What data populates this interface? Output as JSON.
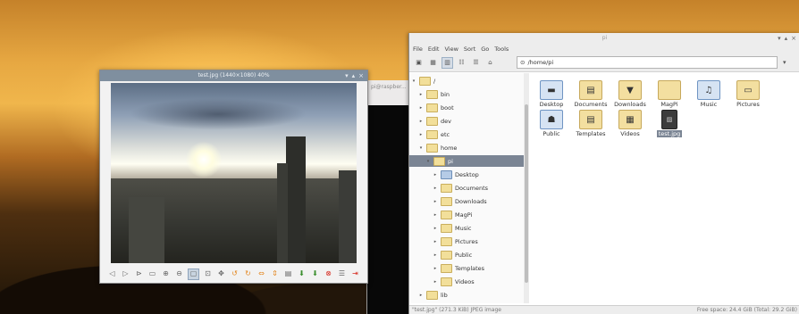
{
  "viewer": {
    "title": "test.jpg (1440×1080) 40%",
    "toolbar": [
      "prev",
      "next",
      "first",
      "last",
      "zoom-in",
      "zoom-out",
      "fit",
      "original",
      "fullscreen",
      "rotate-left",
      "rotate-right",
      "flip-h",
      "flip-v",
      "open",
      "save",
      "save-as",
      "delete",
      "prefs",
      "quit"
    ]
  },
  "background_terminal": {
    "title": "pi@raspber..."
  },
  "filemanager": {
    "title": "pi",
    "menu": [
      "File",
      "Edit",
      "View",
      "Sort",
      "Go",
      "Tools"
    ],
    "path": "/home/pi",
    "tree": [
      {
        "label": "/",
        "depth": 0,
        "arrow": "▾"
      },
      {
        "label": "bin",
        "depth": 1,
        "arrow": "▸"
      },
      {
        "label": "boot",
        "depth": 1,
        "arrow": "▸"
      },
      {
        "label": "dev",
        "depth": 1,
        "arrow": "▸"
      },
      {
        "label": "etc",
        "depth": 1,
        "arrow": "▸"
      },
      {
        "label": "home",
        "depth": 1,
        "arrow": "▾"
      },
      {
        "label": "pi",
        "depth": 2,
        "arrow": "▾",
        "selected": true
      },
      {
        "label": "Desktop",
        "depth": 3,
        "arrow": "▸",
        "icon": "blue"
      },
      {
        "label": "Documents",
        "depth": 3,
        "arrow": "▸"
      },
      {
        "label": "Downloads",
        "depth": 3,
        "arrow": "▸"
      },
      {
        "label": "MagPi",
        "depth": 3,
        "arrow": "▸"
      },
      {
        "label": "Music",
        "depth": 3,
        "arrow": "▸"
      },
      {
        "label": "Pictures",
        "depth": 3,
        "arrow": "▸"
      },
      {
        "label": "Public",
        "depth": 3,
        "arrow": "▸"
      },
      {
        "label": "Templates",
        "depth": 3,
        "arrow": "▸"
      },
      {
        "label": "Videos",
        "depth": 3,
        "arrow": "▸"
      },
      {
        "label": "lib",
        "depth": 1,
        "arrow": "▸"
      }
    ],
    "icons": [
      {
        "label": "Desktop",
        "icon": "desktop-folder-icon",
        "glyph": "▬",
        "kind": "blue"
      },
      {
        "label": "Documents",
        "icon": "documents-folder-icon",
        "glyph": "▤",
        "kind": ""
      },
      {
        "label": "Downloads",
        "icon": "downloads-folder-icon",
        "glyph": "▼",
        "kind": ""
      },
      {
        "label": "MagPi",
        "icon": "folder-icon",
        "glyph": "",
        "kind": ""
      },
      {
        "label": "Music",
        "icon": "music-folder-icon",
        "glyph": "♫",
        "kind": "blue"
      },
      {
        "label": "Pictures",
        "icon": "pictures-folder-icon",
        "glyph": "▭",
        "kind": ""
      },
      {
        "label": "Public",
        "icon": "public-folder-icon",
        "glyph": "☗",
        "kind": "blue"
      },
      {
        "label": "Templates",
        "icon": "templates-folder-icon",
        "glyph": "▤",
        "kind": ""
      },
      {
        "label": "Videos",
        "icon": "videos-folder-icon",
        "glyph": "▦",
        "kind": ""
      },
      {
        "label": "test.jpg",
        "icon": "image-file-icon",
        "glyph": "▨",
        "kind": "file",
        "selected": true
      }
    ],
    "status_left": "\"test.jpg\" (271.3 KiB) JPEG image",
    "status_right": "Free space: 24.4 GiB (Total: 29.2 GiB)"
  }
}
